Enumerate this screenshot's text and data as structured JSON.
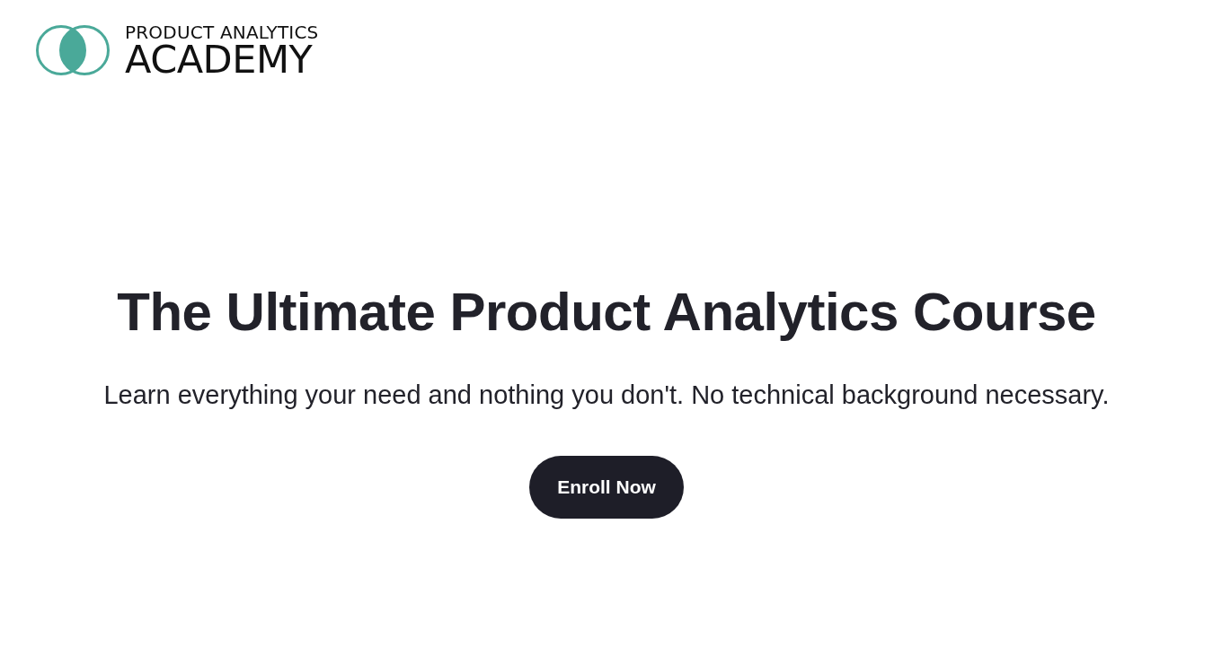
{
  "logo": {
    "line_1": "PRODUCT ANALYTICS",
    "line_2": "ACADEMY"
  },
  "hero": {
    "title": "The Ultimate Product Analytics Course",
    "subtitle": "Learn everything your need and nothing you don't. No technical background necessary.",
    "button": "Enroll Now"
  }
}
